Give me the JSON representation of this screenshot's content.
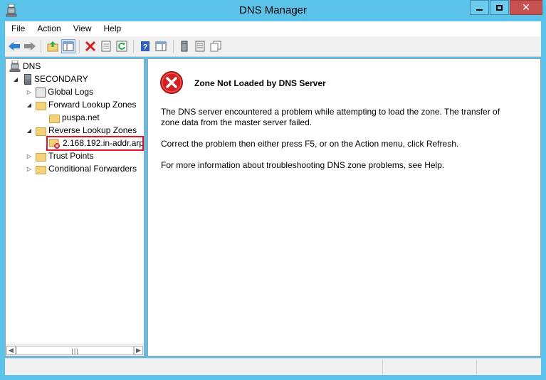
{
  "window": {
    "title": "DNS Manager",
    "close_glyph": "✕"
  },
  "menu": {
    "items": [
      "File",
      "Action",
      "View",
      "Help"
    ]
  },
  "toolbar": {
    "buttons": [
      "back-arrow-icon",
      "forward-arrow-icon",
      "up-folder-icon",
      "show-hide-console-tree-icon",
      "delete-icon",
      "properties-icon",
      "refresh-icon",
      "help-icon",
      "show-hide-action-pane-icon",
      "server-icon",
      "list-icon",
      "copy-icon"
    ]
  },
  "tree": {
    "root": "DNS",
    "server": "SECONDARY",
    "items": {
      "global_logs": "Global Logs",
      "forward_zones": "Forward Lookup Zones",
      "puspa": "puspa.net",
      "reverse_zones": "Reverse Lookup Zones",
      "reverse_zone_item": "2.168.192.in-addr.arp",
      "trust_points": "Trust Points",
      "conditional_forwarders": "Conditional Forwarders"
    }
  },
  "content": {
    "heading": "Zone Not Loaded by DNS Server",
    "paragraph1_line1": "The DNS server encountered a problem while attempting to load the zone. The transfer of",
    "paragraph1_line2": "zone data from the master server failed.",
    "paragraph2": "Correct the problem then either press F5, or on the Action menu, click Refresh.",
    "paragraph3": "For more information about troubleshooting DNS zone problems, see Help."
  },
  "colors": {
    "accent": "#5bc2ea",
    "error_red": "#e81123",
    "highlight": "#e81123"
  }
}
